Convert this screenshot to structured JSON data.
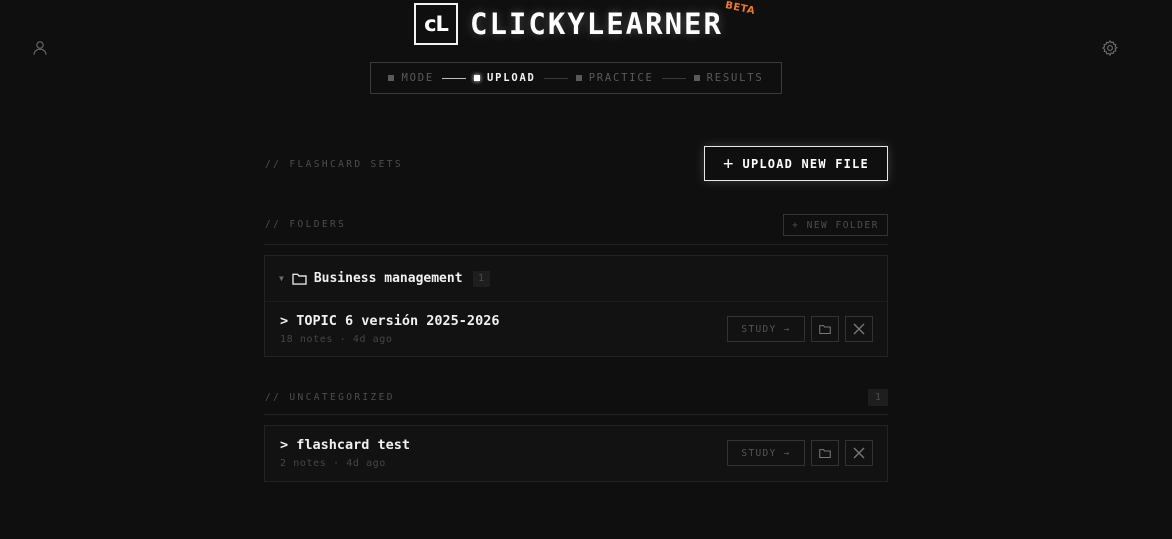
{
  "header": {
    "logo_mark": "cL",
    "brand_name": "CLICKYLEARNER",
    "beta_label": "BETA",
    "user_icon": "user-icon",
    "settings_icon": "gear-icon"
  },
  "stepper": {
    "steps": [
      {
        "label": "MODE",
        "active": false
      },
      {
        "label": "UPLOAD",
        "active": true
      },
      {
        "label": "PRACTICE",
        "active": false
      },
      {
        "label": "RESULTS",
        "active": false
      }
    ]
  },
  "flashcard_sets": {
    "section_label": "// FLASHCARD SETS",
    "upload_button": "UPLOAD NEW FILE"
  },
  "folders": {
    "section_label": "// FOLDERS",
    "new_folder_button": "+ NEW FOLDER",
    "items": [
      {
        "name": "Business management",
        "count": "1",
        "sets": [
          {
            "title": "> TOPIC 6 versión 2025-2026",
            "meta": "18 notes · 4d ago",
            "study_label": "STUDY →"
          }
        ]
      }
    ]
  },
  "uncategorized": {
    "section_label": "// UNCATEGORIZED",
    "count": "1",
    "sets": [
      {
        "title": "> flashcard test",
        "meta": "2 notes · 4d ago",
        "study_label": "STUDY →"
      }
    ]
  },
  "colors": {
    "background": "#0f0f0f",
    "accent_beta": "#f07a1a",
    "text_primary": "#f0f0f0",
    "text_muted": "#4d4d4d"
  }
}
